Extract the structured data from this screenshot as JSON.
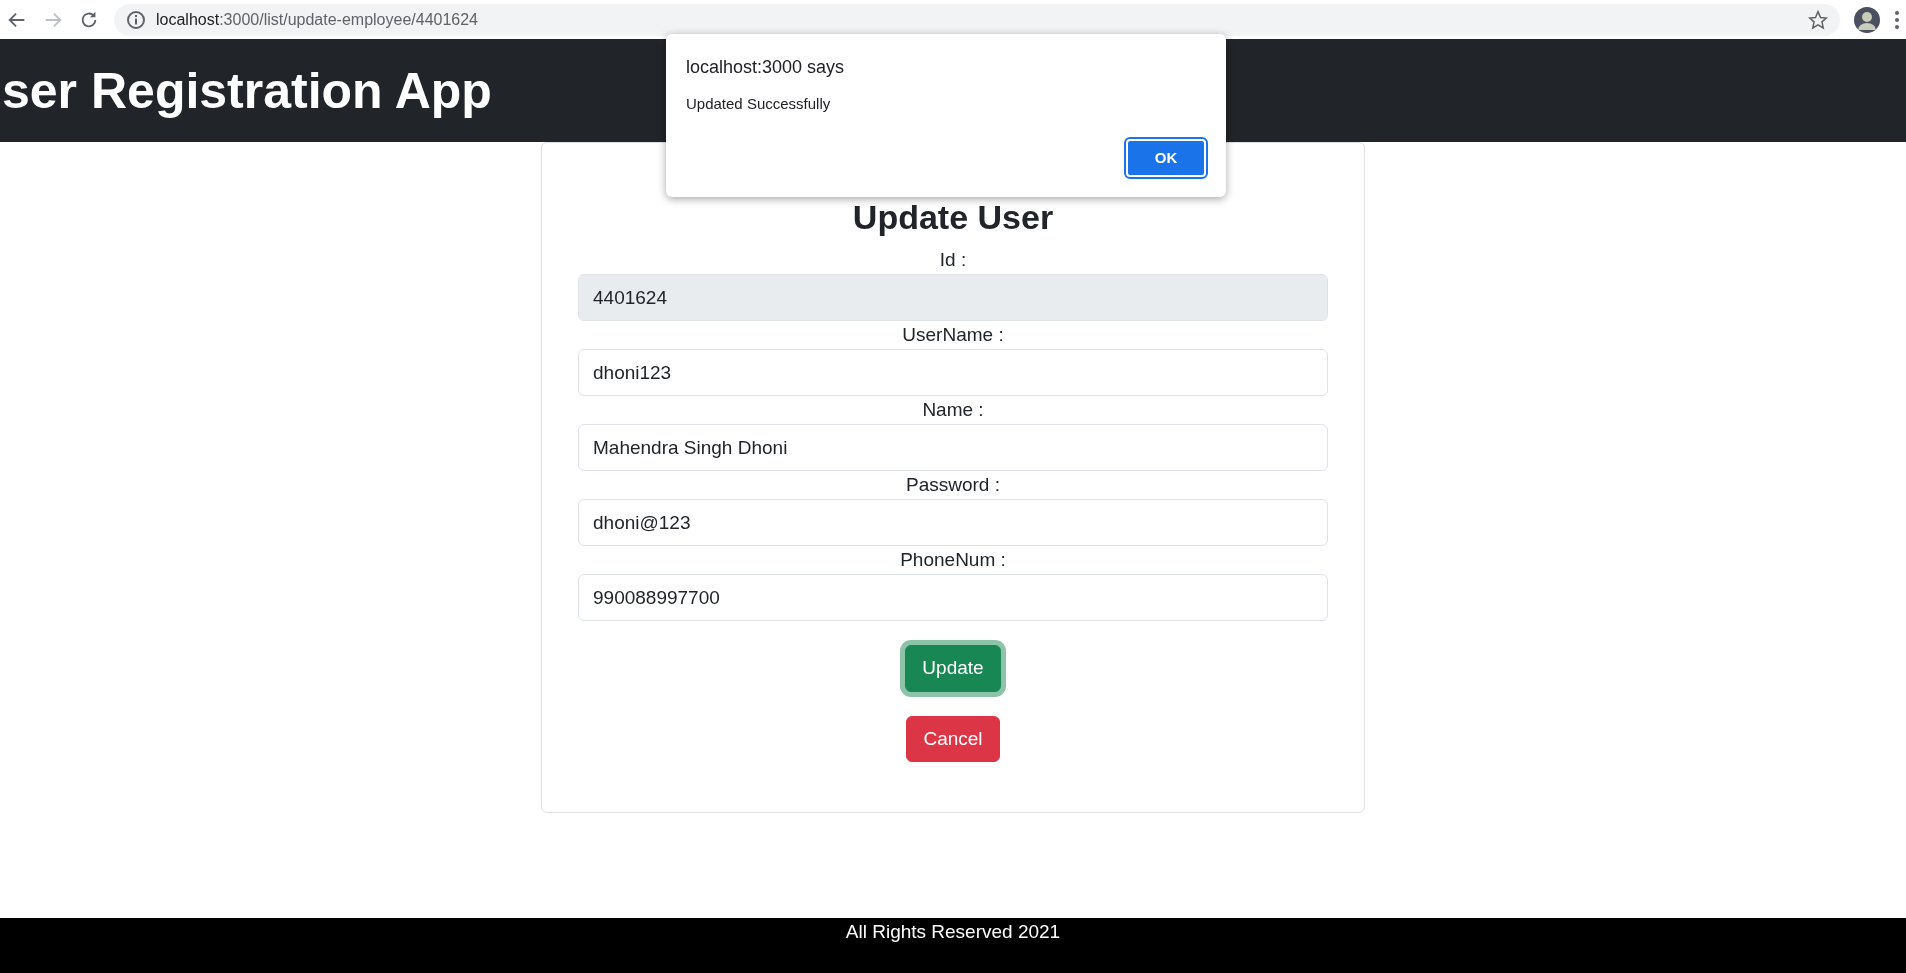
{
  "browser": {
    "url_host": "localhost",
    "url_path": ":3000/list/update-employee/4401624",
    "forward_disabled": true
  },
  "app_title": "ser Registration App",
  "form": {
    "title": "Update User",
    "fields": [
      {
        "label": "Id :",
        "value": "4401624",
        "disabled": true
      },
      {
        "label": "UserName :",
        "value": "dhoni123",
        "disabled": false
      },
      {
        "label": "Name :",
        "value": "Mahendra Singh Dhoni",
        "disabled": false
      },
      {
        "label": "Password :",
        "value": "dhoni@123",
        "disabled": false
      },
      {
        "label": "PhoneNum :",
        "value": "990088997700",
        "disabled": false
      }
    ],
    "buttons": [
      {
        "label": "Update",
        "kind": "success",
        "focused": true
      },
      {
        "label": "Cancel",
        "kind": "danger",
        "focused": false
      }
    ]
  },
  "footer": "All Rights Reserved 2021",
  "dialog": {
    "title": "localhost:3000 says",
    "message": "Updated Successfully",
    "button": "OK"
  }
}
